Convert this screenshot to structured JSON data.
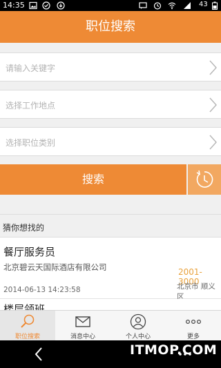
{
  "status_bar": {
    "time": "14:35",
    "battery": "43"
  },
  "title": "职位搜索",
  "fields": [
    {
      "placeholder": "请输入关键字"
    },
    {
      "placeholder": "选择工作地点"
    },
    {
      "placeholder": "选择职位类别"
    }
  ],
  "search_label": "搜索",
  "section_title": "猜你想找的",
  "jobs": [
    {
      "title": "餐厅服务员",
      "company": "北京碧云天国际酒店有限公司",
      "salary": "2001-3000",
      "date": "2014-06-13 14:23:58",
      "location": "北京市 顺义区"
    },
    {
      "title": "楼层领班"
    }
  ],
  "tabs": [
    {
      "label": "职位搜索",
      "icon": "search-icon"
    },
    {
      "label": "消息中心",
      "icon": "mail-icon"
    },
    {
      "label": "个人中心",
      "icon": "person-icon"
    },
    {
      "label": "更多",
      "icon": "more-dots-icon"
    }
  ],
  "watermark": "ITMOP.COM",
  "colors": {
    "accent": "#ee8a35",
    "salary": "#e9a13b",
    "background": "#f0f0f0"
  }
}
